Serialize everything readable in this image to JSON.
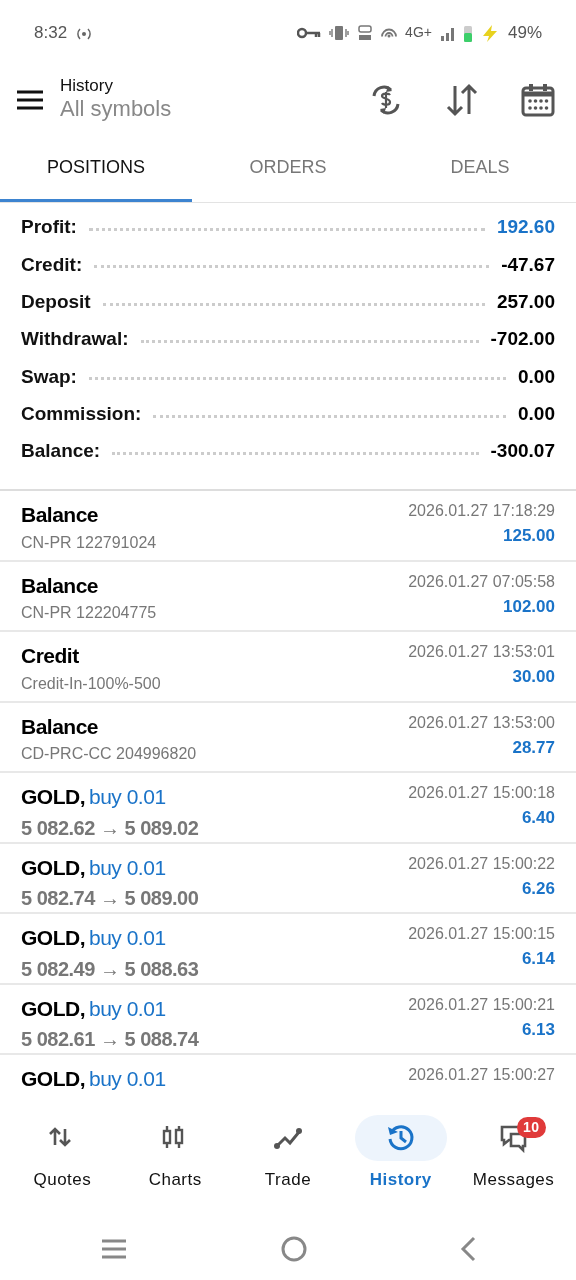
{
  "status_bar": {
    "time": "8:32",
    "network": "4G+",
    "battery": "49%"
  },
  "header": {
    "title": "History",
    "subtitle": "All symbols"
  },
  "tabs": [
    {
      "label": "POSITIONS",
      "selected": true
    },
    {
      "label": "ORDERS",
      "selected": false
    },
    {
      "label": "DEALS",
      "selected": false
    }
  ],
  "summary": [
    {
      "label": "Profit:",
      "value": "192.60",
      "color": "#1a73c8"
    },
    {
      "label": "Credit:",
      "value": "-47.67",
      "color": "#000000"
    },
    {
      "label": "Deposit",
      "value": "257.00",
      "color": "#000000"
    },
    {
      "label": "Withdrawal:",
      "value": "-702.00",
      "color": "#000000"
    },
    {
      "label": "Swap:",
      "value": "0.00",
      "color": "#000000"
    },
    {
      "label": "Commission:",
      "value": "0.00",
      "color": "#000000"
    },
    {
      "label": "Balance:",
      "value": "-300.07",
      "color": "#000000"
    }
  ],
  "deals": [
    {
      "kind": "balance",
      "title": "Balance",
      "comment": "CN-PR 122791024",
      "time": "2026.01.27 17:18:29",
      "amount": "125.00"
    },
    {
      "kind": "balance",
      "title": "Balance",
      "comment": "CN-PR 122204775",
      "time": "2026.01.27 07:05:58",
      "amount": "102.00"
    },
    {
      "kind": "balance",
      "title": "Credit",
      "comment": "Credit-In-100%-500",
      "time": "2026.01.27 13:53:01",
      "amount": "30.00"
    },
    {
      "kind": "balance",
      "title": "Balance",
      "comment": "CD-PRC-CC 204996820",
      "time": "2026.01.27 13:53:00",
      "amount": "28.77"
    },
    {
      "kind": "trade",
      "symbol": "GOLD,",
      "action": "buy 0.01",
      "prices": "5 082.62 → 5 089.02",
      "time": "2026.01.27 15:00:18",
      "amount": "6.40"
    },
    {
      "kind": "trade",
      "symbol": "GOLD,",
      "action": "buy 0.01",
      "prices": "5 082.74 → 5 089.00",
      "time": "2026.01.27 15:00:22",
      "amount": "6.26"
    },
    {
      "kind": "trade",
      "symbol": "GOLD,",
      "action": "buy 0.01",
      "prices": "5 082.49 → 5 088.63",
      "time": "2026.01.27 15:00:15",
      "amount": "6.14"
    },
    {
      "kind": "trade",
      "symbol": "GOLD,",
      "action": "buy 0.01",
      "prices": "5 082.61 → 5 088.74",
      "time": "2026.01.27 15:00:21",
      "amount": "6.13"
    },
    {
      "kind": "trade",
      "symbol": "GOLD,",
      "action": "buy 0.01",
      "time": "2026.01.27 15:00:27"
    }
  ],
  "bottom_nav": [
    {
      "label": "Quotes",
      "selected": false
    },
    {
      "label": "Charts",
      "selected": false
    },
    {
      "label": "Trade",
      "selected": false
    },
    {
      "label": "History",
      "selected": true
    },
    {
      "label": "Messages",
      "selected": false,
      "badge": "10"
    }
  ]
}
